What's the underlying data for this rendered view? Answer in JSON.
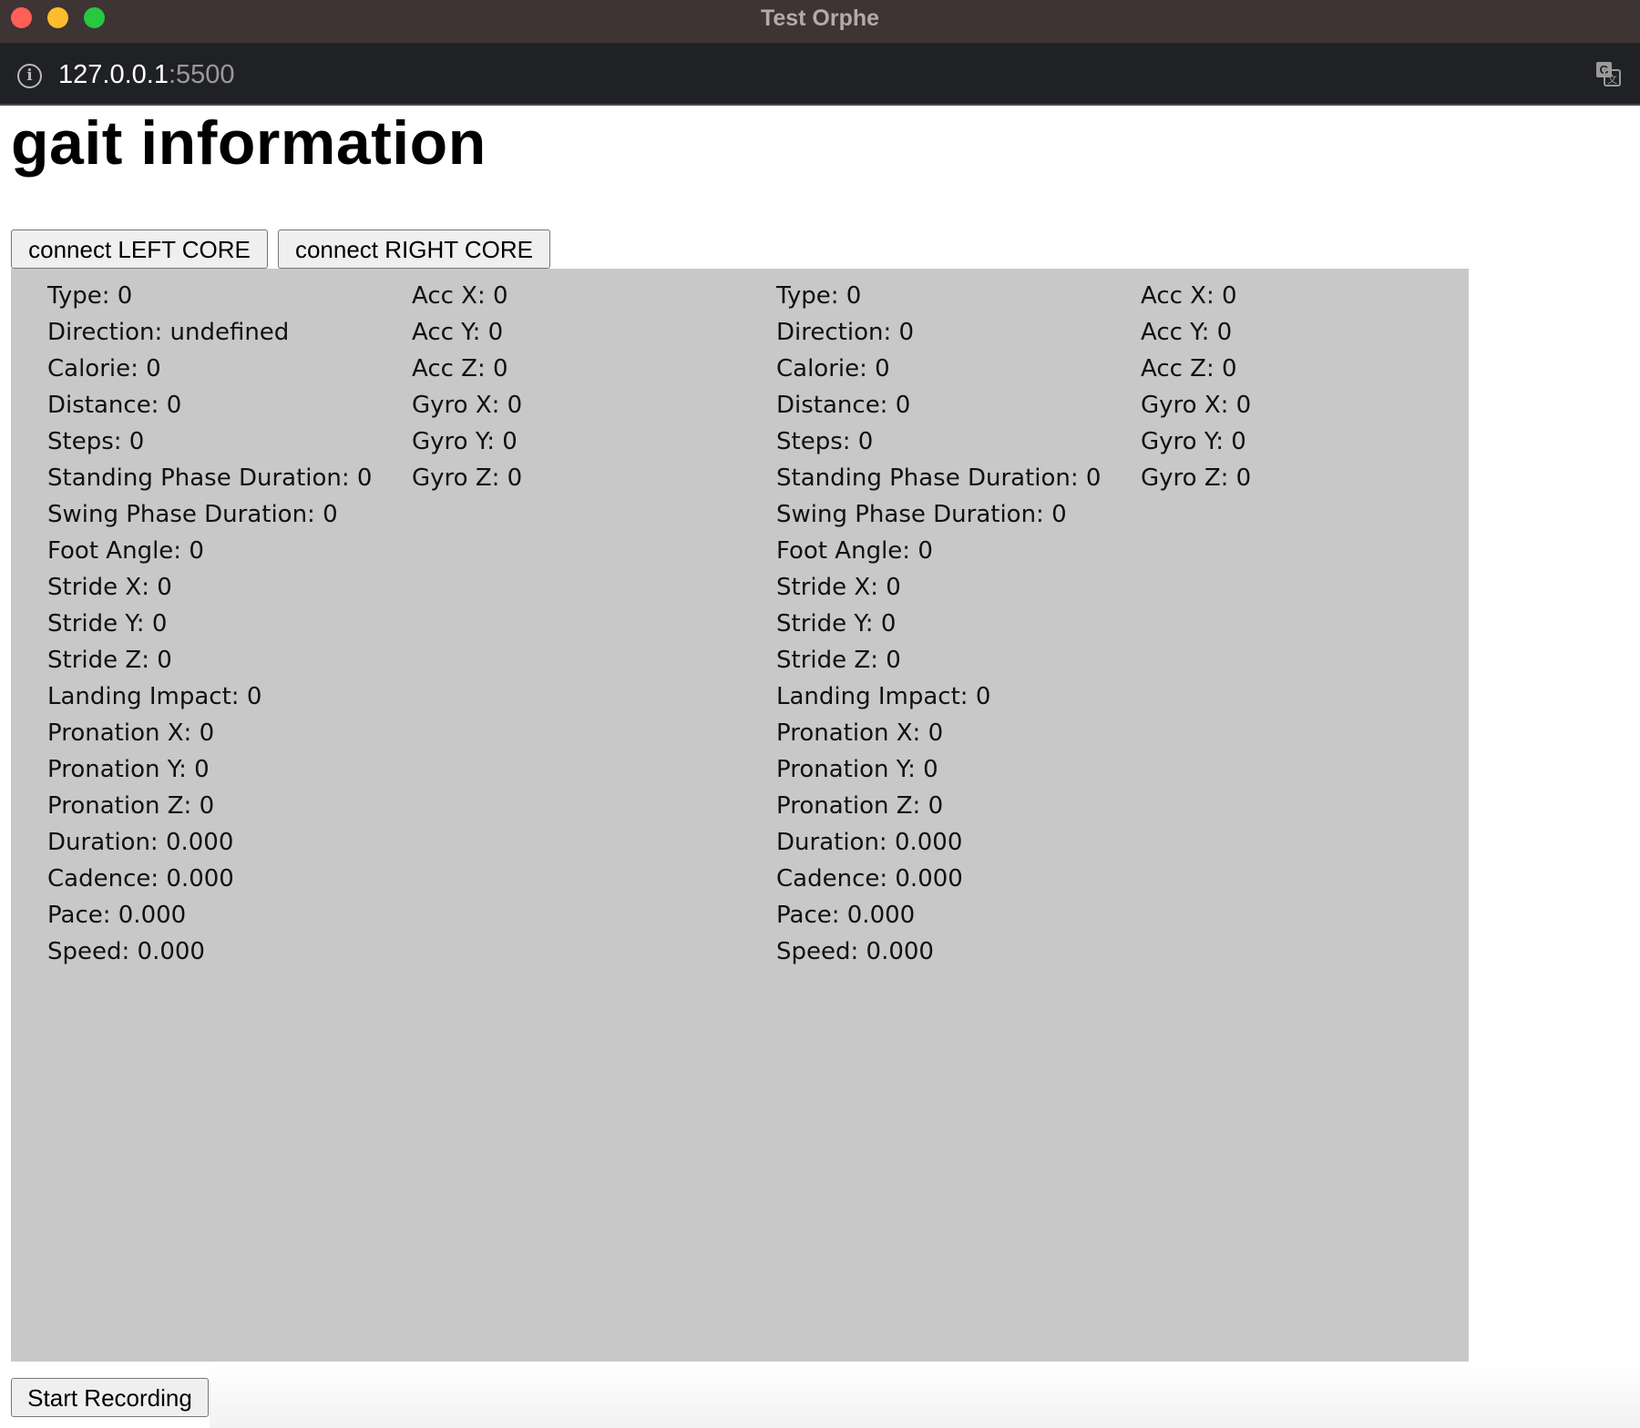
{
  "window": {
    "title": "Test Orphe"
  },
  "address_bar": {
    "host": "127.0.0.1",
    "port": ":5500"
  },
  "page": {
    "heading": "gait information",
    "connect_left_label": "connect LEFT CORE",
    "connect_right_label": "connect RIGHT CORE",
    "record_label": "Start Recording"
  },
  "left": {
    "gait": [
      "Type: 0",
      "Direction: undefined",
      "Calorie: 0",
      "Distance: 0",
      "Steps: 0",
      "Standing Phase Duration: 0",
      "Swing Phase Duration: 0",
      "Foot Angle: 0",
      "Stride X: 0",
      "Stride Y: 0",
      "Stride Z: 0",
      "Landing Impact: 0",
      "Pronation X: 0",
      "Pronation Y: 0",
      "Pronation Z: 0",
      "Duration: 0.000",
      "Cadence: 0.000",
      "Pace: 0.000",
      "Speed: 0.000"
    ],
    "sensor": [
      "Acc X: 0",
      "Acc Y: 0",
      "Acc Z: 0",
      "Gyro X: 0",
      "Gyro Y: 0",
      "Gyro Z: 0"
    ]
  },
  "right": {
    "gait": [
      "Type: 0",
      "Direction: 0",
      "Calorie: 0",
      "Distance: 0",
      "Steps: 0",
      "Standing Phase Duration: 0",
      "Swing Phase Duration: 0",
      "Foot Angle: 0",
      "Stride X: 0",
      "Stride Y: 0",
      "Stride Z: 0",
      "Landing Impact: 0",
      "Pronation X: 0",
      "Pronation Y: 0",
      "Pronation Z: 0",
      "Duration: 0.000",
      "Cadence: 0.000",
      "Pace: 0.000",
      "Speed: 0.000"
    ],
    "sensor": [
      "Acc X: 0",
      "Acc Y: 0",
      "Acc Z: 0",
      "Gyro X: 0",
      "Gyro Y: 0",
      "Gyro Z: 0"
    ]
  },
  "icons": {
    "info": "info-icon",
    "translate": "translate-icon"
  },
  "colors": {
    "panel_bg": "#c8c8c8",
    "titlebar_bg": "#3d3433",
    "addressbar_bg": "#202124"
  }
}
